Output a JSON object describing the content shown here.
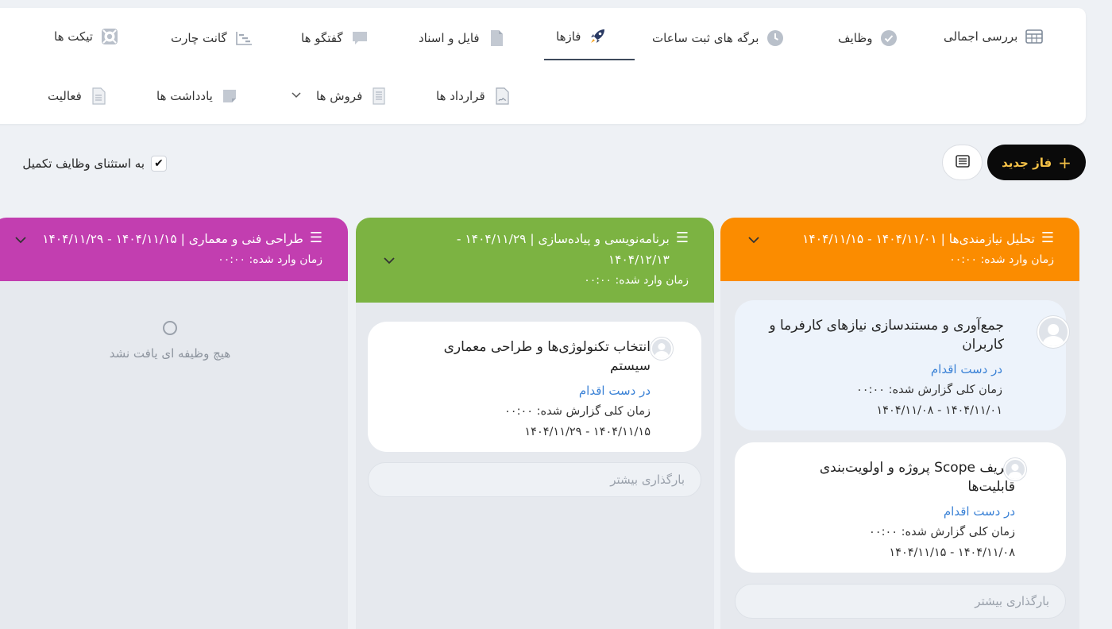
{
  "nav": {
    "row1": [
      {
        "label": "بررسی اجمالی",
        "icon": "table-icon"
      },
      {
        "label": "وظایف",
        "icon": "check-circle-icon"
      },
      {
        "label": "برگه های ثبت ساعات",
        "icon": "clock-icon"
      },
      {
        "label": "فازها",
        "icon": "rocket-icon",
        "active": true
      },
      {
        "label": "فایل و اسناد",
        "icon": "file-icon"
      },
      {
        "label": "گفتگو ها",
        "icon": "chat-icon"
      },
      {
        "label": "گانت چارت",
        "icon": "gantt-icon"
      },
      {
        "label": "تیکت ها",
        "icon": "lifebuoy-icon"
      }
    ],
    "row2": [
      {
        "label": "قرارداد ها",
        "icon": "contract-icon"
      },
      {
        "label": "فروش ها",
        "icon": "receipt-icon",
        "has_dropdown": true
      },
      {
        "label": "یادداشت ها",
        "icon": "note-icon"
      },
      {
        "label": "فعالیت",
        "icon": "document-icon"
      }
    ]
  },
  "toolbar": {
    "new_phase_label": "فاز جدید",
    "view_toggle_icon": "list-view-icon",
    "exclude_completed_label": "به استثنای وظایف تکمیل",
    "exclude_completed_checked": true
  },
  "phases": [
    {
      "title": "تحلیل نیازمندی‌ها | ۱۴۰۴/۱۱/۰۱ - ۱۴۰۴/۱۱/۱۵",
      "time": "زمان وارد شده: ۰۰:۰۰",
      "color": "#fb8c00",
      "tasks": [
        {
          "title": "جمع‌آوری و مستندسازی نیازهای کارفرما و کاربران",
          "status": "در دست اقدام",
          "reported": "زمان کلی گزارش شده: ۰۰:۰۰",
          "dates": "۱۴۰۴/۱۱/۰۱ - ۱۴۰۴/۱۱/۰۸"
        },
        {
          "title": "تعریف Scope پروژه و اولویت‌بندی قابلیت‌ها",
          "status": "در دست اقدام",
          "reported": "زمان کلی گزارش شده: ۰۰:۰۰",
          "dates": "۱۴۰۴/۱۱/۰۸ - ۱۴۰۴/۱۱/۱۵"
        }
      ],
      "load_more": "بارگذاری بیشتر"
    },
    {
      "title": "برنامه‌نویسی و پیاده‌سازی | ۱۴۰۴/۱۱/۲۹ - ۱۴۰۴/۱۲/۱۳",
      "time": "زمان وارد شده: ۰۰:۰۰",
      "color": "#7cb342",
      "tasks": [
        {
          "title": "انتخاب تکنولوژی‌ها و طراحی معماری سیستم",
          "status": "در دست اقدام",
          "reported": "زمان کلی گزارش شده: ۰۰:۰۰",
          "dates": "۱۴۰۴/۱۱/۱۵ - ۱۴۰۴/۱۱/۲۹"
        }
      ],
      "load_more": "بارگذاری بیشتر"
    },
    {
      "title": "طراحی فنی و معماری | ۱۴۰۴/۱۱/۱۵ - ۱۴۰۴/۱۱/۲۹",
      "time": "زمان وارد شده: ۰۰:۰۰",
      "color": "#c23eb0",
      "empty_text": "هیچ وظیفه ای یافت نشد"
    }
  ]
}
